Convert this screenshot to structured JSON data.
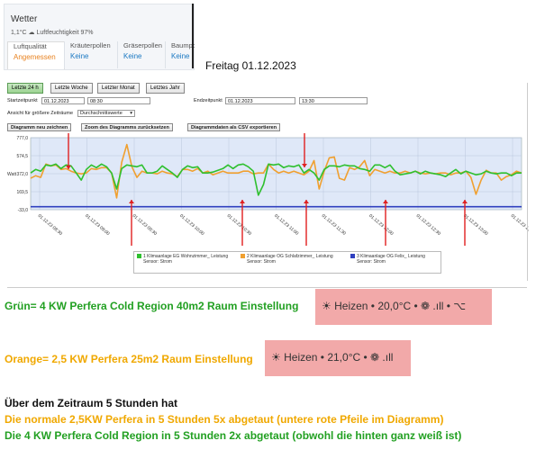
{
  "weather": {
    "title": "Wetter",
    "subtitle": "1,1°C  ☁  Luftfeuchtigkeit 97%",
    "cells": [
      {
        "label": "Luftqualität",
        "value": "Angemessen",
        "color": "#e8821f"
      },
      {
        "label": "Kräuterpollen",
        "value": "Keine",
        "color": "#1a78c2"
      },
      {
        "label": "Gräserpollen",
        "value": "Keine",
        "color": "#1a78c2"
      },
      {
        "label": "Baumpo",
        "value": "Keine",
        "color": "#1a78c2"
      }
    ]
  },
  "date_label": "Freitag 01.12.2023",
  "toolbar": {
    "tabs": [
      "Letzte 24 h",
      "Letzte Woche",
      "Letzter Monat",
      "Letztes Jahr"
    ],
    "start_label": "Startzeitpunkt",
    "start_date": "01.12.2023",
    "start_time": "08:30",
    "end_label": "Endzeitpunkt",
    "end_date": "01.12.2023",
    "end_time": "13:30",
    "view_label": "Ansicht für größere Zeiträume",
    "view_value": "Durchschnittswerte",
    "btn_redraw": "Diagramm neu zeichnen",
    "btn_zoom": "Zoom des Diagramms zurücksetzen",
    "btn_csv": "Diagrammdaten als CSV exportieren"
  },
  "chart_data": {
    "type": "line",
    "ylabel": "Watt",
    "yticks": [
      "777,0",
      "574,5",
      "372,0",
      "169,5",
      "-33,0"
    ],
    "ylim": [
      -33,
      777
    ],
    "grid": true,
    "xticks": [
      "01.12.23 08:30",
      "01.12.23 09:00",
      "01.12.23 09:30",
      "01.12.23 10:00",
      "01.12.23 10:30",
      "01.12.23 11:00",
      "01.12.23 11:30",
      "01.12.23 12:00",
      "01.12.23 12:30",
      "01.12.23 13:00",
      "01.12.23 13:30"
    ],
    "series": [
      {
        "name": "1 Klimaanlage EG Wohnzimmer_ Leistung",
        "color": "#2fc02f",
        "values": [
          380,
          420,
          400,
          470,
          460,
          480,
          430,
          470,
          460,
          380,
          300,
          420,
          470,
          440,
          480,
          450,
          380,
          200,
          430,
          470,
          460,
          450,
          470,
          380,
          380,
          400,
          460,
          420,
          380,
          330,
          420,
          460,
          440,
          450,
          380,
          380,
          390,
          410,
          430,
          470,
          430,
          470,
          480,
          450,
          400,
          130,
          250,
          480,
          470,
          480,
          440,
          460,
          450,
          470,
          380,
          420,
          380,
          300,
          420,
          460,
          460,
          450,
          470,
          460,
          460,
          430,
          420,
          400,
          470,
          470,
          440,
          470,
          400,
          360,
          370,
          380,
          400,
          370,
          400,
          380,
          370,
          360,
          340,
          380,
          420,
          370,
          400,
          380,
          360,
          370,
          400,
          380,
          370,
          380,
          380,
          350,
          380,
          380
        ]
      },
      {
        "name": "2 Klimaanlage OG Schlafzimmer_ Leistung",
        "color": "#f0a030",
        "values": [
          320,
          350,
          330,
          480,
          460,
          470,
          420,
          430,
          400,
          380,
          370,
          380,
          430,
          420,
          440,
          440,
          380,
          100,
          500,
          700,
          450,
          330,
          400,
          380,
          380,
          370,
          400,
          380,
          370,
          340,
          420,
          420,
          400,
          430,
          380,
          400,
          360,
          380,
          400,
          380,
          380,
          380,
          400,
          400,
          370,
          380,
          380,
          480,
          420,
          380,
          400,
          380,
          400,
          380,
          360,
          400,
          520,
          200,
          400,
          550,
          560,
          320,
          300,
          440,
          420,
          450,
          520,
          350,
          420,
          400,
          380,
          400,
          380,
          380,
          400,
          380,
          400,
          380,
          370,
          380,
          370,
          380,
          380,
          360,
          380,
          380,
          400,
          330,
          140,
          300,
          410,
          380,
          380,
          300,
          340,
          360,
          400,
          380
        ]
      },
      {
        "name": "3 Klimaanlage OG Felix_ Leistung",
        "color": "#2f3fbf",
        "values": [
          0,
          0,
          0,
          0,
          0,
          0,
          0,
          0,
          0,
          0,
          0,
          0,
          0,
          0,
          0,
          0,
          0,
          0,
          0,
          0,
          0,
          0,
          0,
          0,
          0,
          0,
          0,
          0,
          0,
          0,
          0,
          0,
          0,
          0,
          0,
          0,
          0,
          0,
          0,
          0,
          0,
          0,
          0,
          0,
          0,
          0,
          0,
          0,
          0,
          0,
          0,
          0,
          0,
          0,
          0,
          0,
          0,
          0,
          0,
          0,
          0,
          0,
          0,
          0,
          0,
          0,
          0,
          0,
          0,
          0,
          0,
          0,
          0,
          0,
          0,
          0,
          0,
          0,
          0,
          0,
          0,
          0,
          0,
          0,
          0,
          0,
          0,
          0,
          0,
          0,
          0,
          0,
          0,
          0,
          0,
          0,
          0,
          0
        ]
      }
    ],
    "legend_sensor": "Sensor: Strom"
  },
  "notes": {
    "green_line": "Grün=   4 KW Perfera Cold Region 40m2 Raum Einstellung",
    "green_chip": "Heizen • 20,0°C • ❁ .ıll • ⌥",
    "orange_line": "Orange= 2,5 KW Perfera 25m2 Raum Einstellung",
    "orange_chip": "Heizen • 21,0°C • ❁ .ıll",
    "summary_heading": "Über dem Zeitraum 5 Stunden hat",
    "summary_orange": "Die normale 2,5KW Perfera in 5 Stunden 5x abgetaut (untere rote Pfeile im Diagramm)",
    "summary_green": "Die 4 KW Perfera Cold Region in 5 Stunden 2x abgetaut (obwohl die hinten ganz weiß ist)",
    "color_green": "#22a022",
    "color_orange": "#f0a800"
  }
}
